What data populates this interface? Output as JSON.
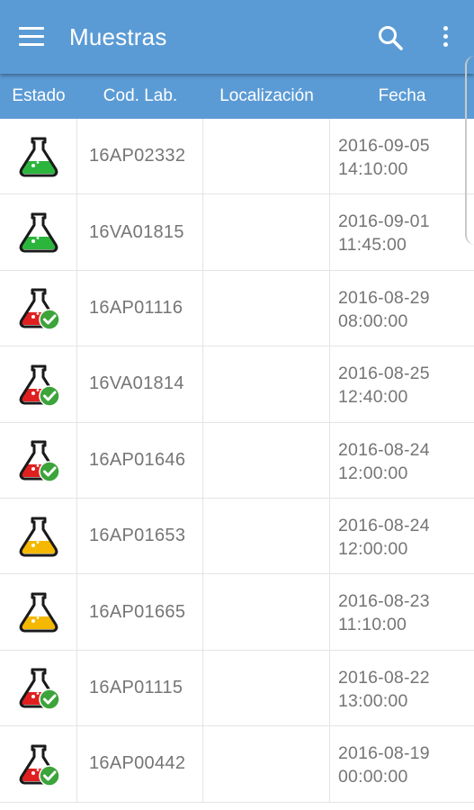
{
  "app": {
    "title": "Muestras",
    "primary_color": "#5b9bd5"
  },
  "toolbar": {
    "menu_icon": "hamburger-menu-icon",
    "search_icon": "search-icon",
    "more_icon": "more-vert-icon"
  },
  "table": {
    "headers": [
      "Estado",
      "Cod. Lab.",
      "Localización",
      "Fecha"
    ],
    "rows": [
      {
        "status": "green",
        "code": "16AP02332",
        "location": "",
        "date": "2016-09-05",
        "time": "14:10:00"
      },
      {
        "status": "green",
        "code": "16VA01815",
        "location": "",
        "date": "2016-09-01",
        "time": "11:45:00"
      },
      {
        "status": "red-check",
        "code": "16AP01116",
        "location": "",
        "date": "2016-08-29",
        "time": "08:00:00"
      },
      {
        "status": "red-check",
        "code": "16VA01814",
        "location": "",
        "date": "2016-08-25",
        "time": "12:40:00"
      },
      {
        "status": "red-check",
        "code": "16AP01646",
        "location": "",
        "date": "2016-08-24",
        "time": "12:00:00"
      },
      {
        "status": "yellow",
        "code": "16AP01653",
        "location": "",
        "date": "2016-08-24",
        "time": "12:00:00"
      },
      {
        "status": "yellow",
        "code": "16AP01665",
        "location": "",
        "date": "2016-08-23",
        "time": "11:10:00"
      },
      {
        "status": "red-check",
        "code": "16AP01115",
        "location": "",
        "date": "2016-08-22",
        "time": "13:00:00"
      },
      {
        "status": "red-check",
        "code": "16AP00442",
        "location": "",
        "date": "2016-08-19",
        "time": "00:00:00"
      }
    ]
  },
  "status_colors": {
    "green": "#2bb53c",
    "yellow": "#f5b800",
    "red": "#e02020",
    "check": "#3ca43a"
  }
}
